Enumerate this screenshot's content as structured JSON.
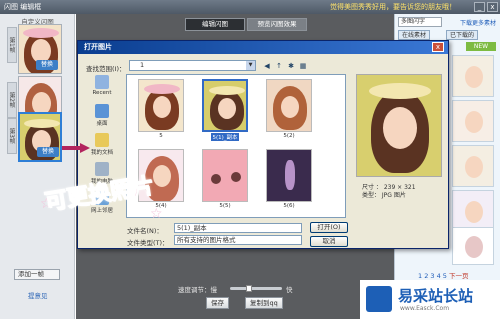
{
  "app": {
    "title": "闪图 编辑框",
    "slogan": "觉得美图秀秀好用，要告诉您的朋友哦！",
    "win_min": "_",
    "win_close": "x"
  },
  "left_panel": {
    "title": "自定义闪图",
    "frames": [
      {
        "label": "第1帧",
        "swap": "替换"
      },
      {
        "label": "第2帧",
        "swap": "替换"
      },
      {
        "label": "第3帧",
        "swap": "替换"
      }
    ],
    "add_frame": "添加一帧",
    "feedback": "提意见"
  },
  "center": {
    "tabs": [
      {
        "label": "编辑闪图",
        "active": true
      },
      {
        "label": "预览闪图效果",
        "active": false
      }
    ],
    "speed_label": "速度调节：慢",
    "speed_fast": "快",
    "speed_level": 0.35,
    "save": "保存",
    "copy": "复制到qq"
  },
  "right_panel": {
    "category": "多图闪字",
    "download_more": "下载更多素材",
    "tabs": [
      "在线素材",
      "已下载的"
    ],
    "new_btn": "NEW",
    "pager": "1 2 3 4 5",
    "next": "下一页"
  },
  "dialog": {
    "title": "打开图片",
    "close": "x",
    "look_in_label": "查找范围(I)：",
    "look_in_value": "1",
    "places": [
      "Recent",
      "桌面",
      "我的文档",
      "我的电脑",
      "网上邻居"
    ],
    "files": [
      {
        "name": "5",
        "selected": false
      },
      {
        "name": "5(1)_副本",
        "selected": true
      },
      {
        "name": "5(2)",
        "selected": false
      },
      {
        "name": "5(4)",
        "selected": false
      },
      {
        "name": "5(5)",
        "selected": false
      },
      {
        "name": "5(6)",
        "selected": false
      }
    ],
    "filename_label": "文件名(N)：",
    "filename_value": "5(1)_副本",
    "filetype_label": "文件类型(T)：",
    "filetype_value": "所有支持的图片格式",
    "open": "打开(O)",
    "cancel": "取消",
    "size": "尺寸 ： 239 × 321",
    "type": "类型： JPG 图片"
  },
  "overlay": {
    "caption": "可更换照片"
  },
  "watermark": {
    "brand": "易采站长站",
    "site": "www.Easck.Com"
  },
  "colors": {
    "dialog_title": "#0a3d8f",
    "selection": "#316ac5",
    "caption": "#d83c80",
    "brand": "#1d5fb6"
  }
}
